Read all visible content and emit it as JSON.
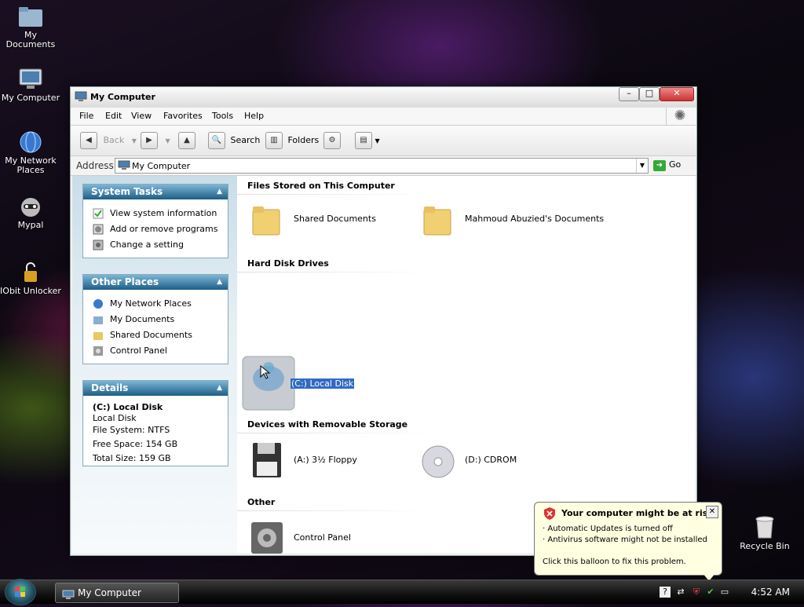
{
  "desktop": {
    "icons": [
      {
        "label": "My Documents"
      },
      {
        "label": "My Computer"
      },
      {
        "label": "My Network Places"
      },
      {
        "label": "Mypal"
      },
      {
        "label": "IObit Unlocker"
      }
    ],
    "recycle_bin": "Recycle Bin"
  },
  "window": {
    "title": "My Computer",
    "menu": [
      "File",
      "Edit",
      "View",
      "Favorites",
      "Tools",
      "Help"
    ],
    "toolbar": {
      "back": "Back",
      "search": "Search",
      "folders": "Folders"
    },
    "address": {
      "label": "Address",
      "value": "My Computer",
      "go": "Go"
    }
  },
  "taskpane": {
    "system_tasks": {
      "title": "System Tasks",
      "items": [
        "View system information",
        "Add or remove programs",
        "Change a setting"
      ]
    },
    "other_places": {
      "title": "Other Places",
      "items": [
        "My Network Places",
        "My Documents",
        "Shared Documents",
        "Control Panel"
      ]
    },
    "details": {
      "title": "Details",
      "name": "(C:) Local Disk",
      "type": "Local Disk",
      "fs": "File System: NTFS",
      "free": "Free Space: 154 GB",
      "total": "Total Size: 159 GB"
    }
  },
  "content": {
    "groups": [
      {
        "title": "Files Stored on This Computer",
        "items": [
          "Shared Documents",
          "Mahmoud Abuzied's Documents"
        ]
      },
      {
        "title": "Hard Disk Drives",
        "items": [
          "(C:) Local Disk"
        ]
      },
      {
        "title": "Devices with Removable Storage",
        "items": [
          "(A:) 3½ Floppy",
          "(D:) CDROM"
        ]
      },
      {
        "title": "Other",
        "items": [
          "Control Panel"
        ]
      }
    ]
  },
  "balloon": {
    "title": "Your computer might be at risk",
    "line1": "· Automatic Updates is turned off",
    "line2": "· Antivirus software might not be installed",
    "line3": "Click this balloon to fix this problem."
  },
  "taskbar": {
    "task": "My Computer",
    "clock": "4:52 AM"
  },
  "colors": {
    "panel_head": "#1d5e86",
    "selection": "#316ac5",
    "balloon_bg": "#ffffe1"
  }
}
